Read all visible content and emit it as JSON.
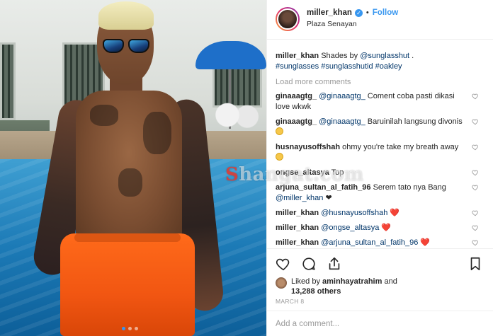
{
  "header": {
    "username": "miller_khan",
    "verified_icon": "verified-badge-icon",
    "bullet": "•",
    "follow_label": "Follow",
    "location": "Plaza Senayan"
  },
  "caption": {
    "username": "miller_khan",
    "text_1": " Shades by ",
    "mention": "@sunglasshut",
    "text_2": " .",
    "hashtags": "#sunglasses #sunglasshutid #oakley"
  },
  "load_more_label": "Load more comments",
  "comments": [
    {
      "user": "ginaaagtg_",
      "mention": "@ginaaagtg_",
      "text": " Coment coba pasti dikasi love wkwk",
      "suffix": ""
    },
    {
      "user": "ginaaagtg_",
      "mention": "@ginaaagtg_",
      "text": " Baruinilah langsung divonis",
      "suffix": ""
    },
    {
      "user": "husnayusoffshah",
      "mention": "",
      "text": " ohmy you're take my breath away ",
      "suffix": ""
    },
    {
      "user": "ongse_altasya",
      "mention": "",
      "text": " Top",
      "suffix": ""
    },
    {
      "user": "arjuna_sultan_al_fatih_96",
      "mention": "@miller_khan",
      "text": " Serem tato nya Bang ",
      "suffix": "❤"
    },
    {
      "user": "miller_khan",
      "mention": "@husnayusoffshah",
      "text": " ",
      "suffix": "❤️"
    },
    {
      "user": "miller_khan",
      "mention": "@ongse_altasya",
      "text": " ",
      "suffix": "❤️"
    },
    {
      "user": "miller_khan",
      "mention": "@arjuna_sultan_al_fatih_96",
      "text": " ",
      "suffix": "❤️"
    }
  ],
  "likes": {
    "prefix": "Liked by ",
    "user": "aminhayatrahim",
    "and": " and",
    "count": "13,288 others"
  },
  "date": "MARCH 8",
  "add_comment_placeholder": "Add a comment...",
  "watermark": {
    "s": "S",
    "rest": "hangat.com"
  },
  "carousel": {
    "total": 3,
    "active": 1
  }
}
